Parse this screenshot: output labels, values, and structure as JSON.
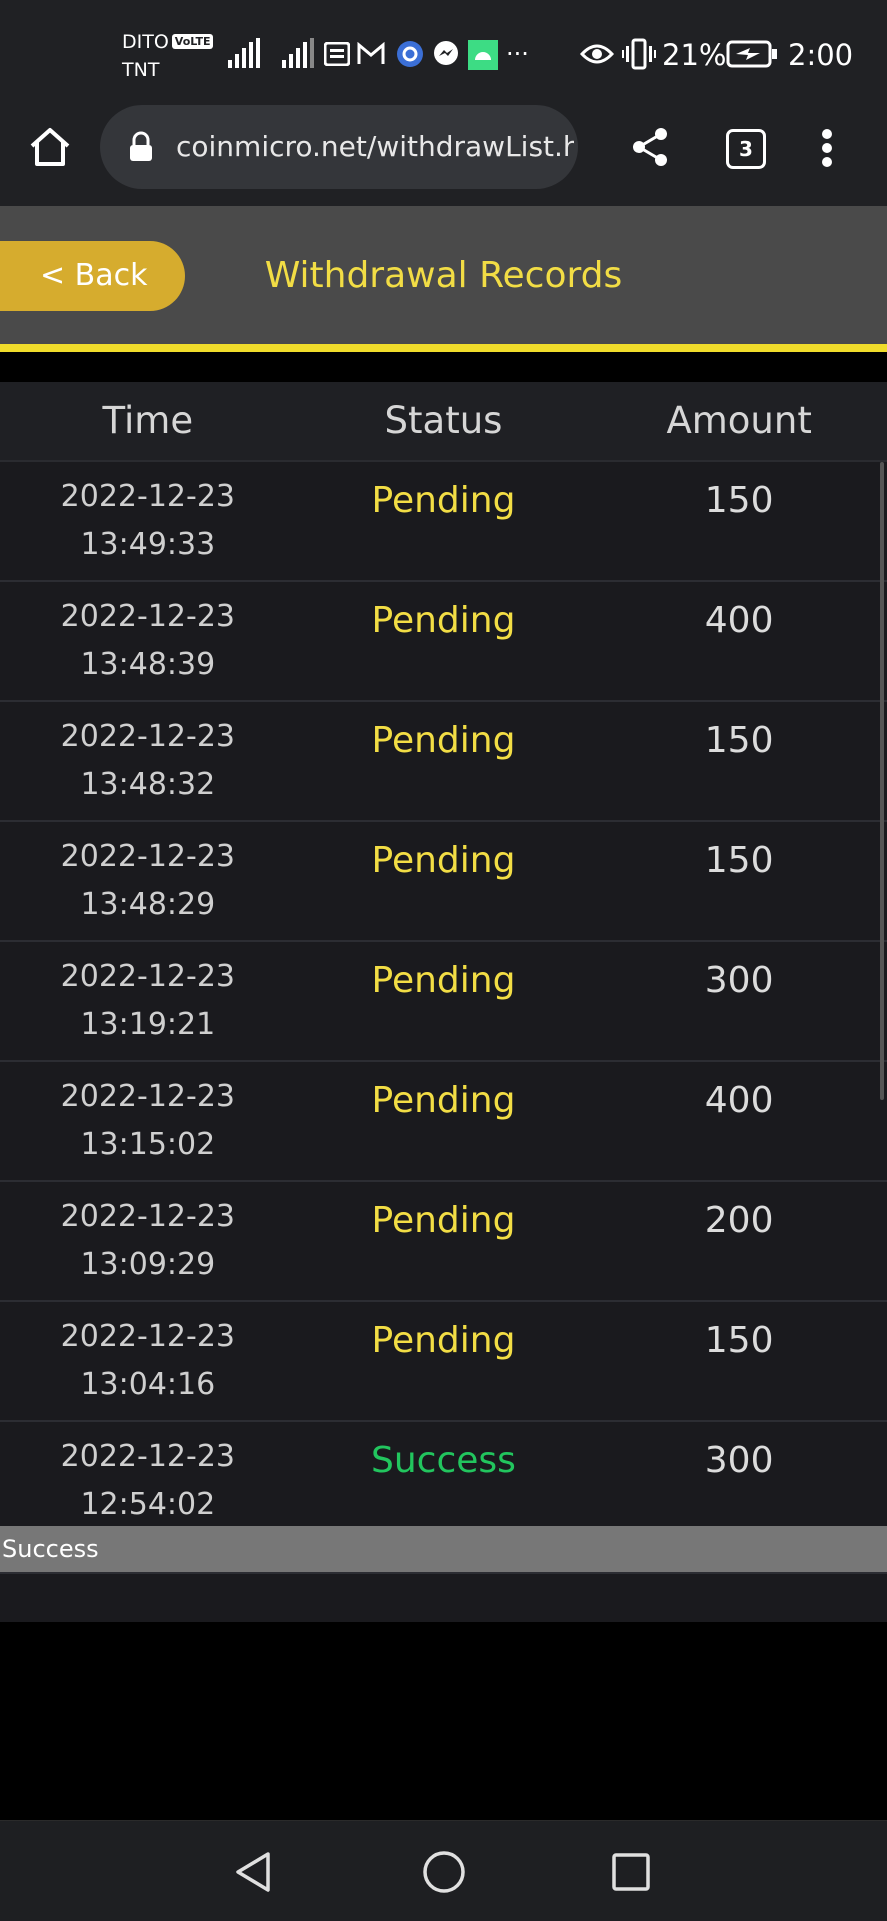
{
  "status_bar": {
    "carrier_primary": "DITO",
    "volte_badge": "VoLTE",
    "carrier_secondary": "TNT",
    "more_indicator": "···",
    "battery_percent": "21%",
    "time": "2:00"
  },
  "browser": {
    "url": "coinmicro.net/withdrawList.ht",
    "tab_count": "3"
  },
  "header": {
    "back_label": "< Back",
    "title": "Withdrawal Records"
  },
  "table": {
    "columns": [
      "Time",
      "Status",
      "Amount"
    ],
    "rows": [
      {
        "date": "2022-12-23",
        "time": "13:49:33",
        "status": "Pending",
        "amount": "150"
      },
      {
        "date": "2022-12-23",
        "time": "13:48:39",
        "status": "Pending",
        "amount": "400"
      },
      {
        "date": "2022-12-23",
        "time": "13:48:32",
        "status": "Pending",
        "amount": "150"
      },
      {
        "date": "2022-12-23",
        "time": "13:48:29",
        "status": "Pending",
        "amount": "150"
      },
      {
        "date": "2022-12-23",
        "time": "13:19:21",
        "status": "Pending",
        "amount": "300"
      },
      {
        "date": "2022-12-23",
        "time": "13:15:02",
        "status": "Pending",
        "amount": "400"
      },
      {
        "date": "2022-12-23",
        "time": "13:09:29",
        "status": "Pending",
        "amount": "200"
      },
      {
        "date": "2022-12-23",
        "time": "13:04:16",
        "status": "Pending",
        "amount": "150"
      },
      {
        "date": "2022-12-23",
        "time": "12:54:02",
        "status": "Success",
        "amount": "300"
      }
    ]
  },
  "tooltip": {
    "text": "Success"
  },
  "colors": {
    "accent_gold": "#d6ac2e",
    "title_yellow": "#f2dd45",
    "pending": "#f2dd45",
    "success": "#22c55e",
    "header_bg": "#4a4a4a",
    "row_bg": "#1a1a1e"
  }
}
